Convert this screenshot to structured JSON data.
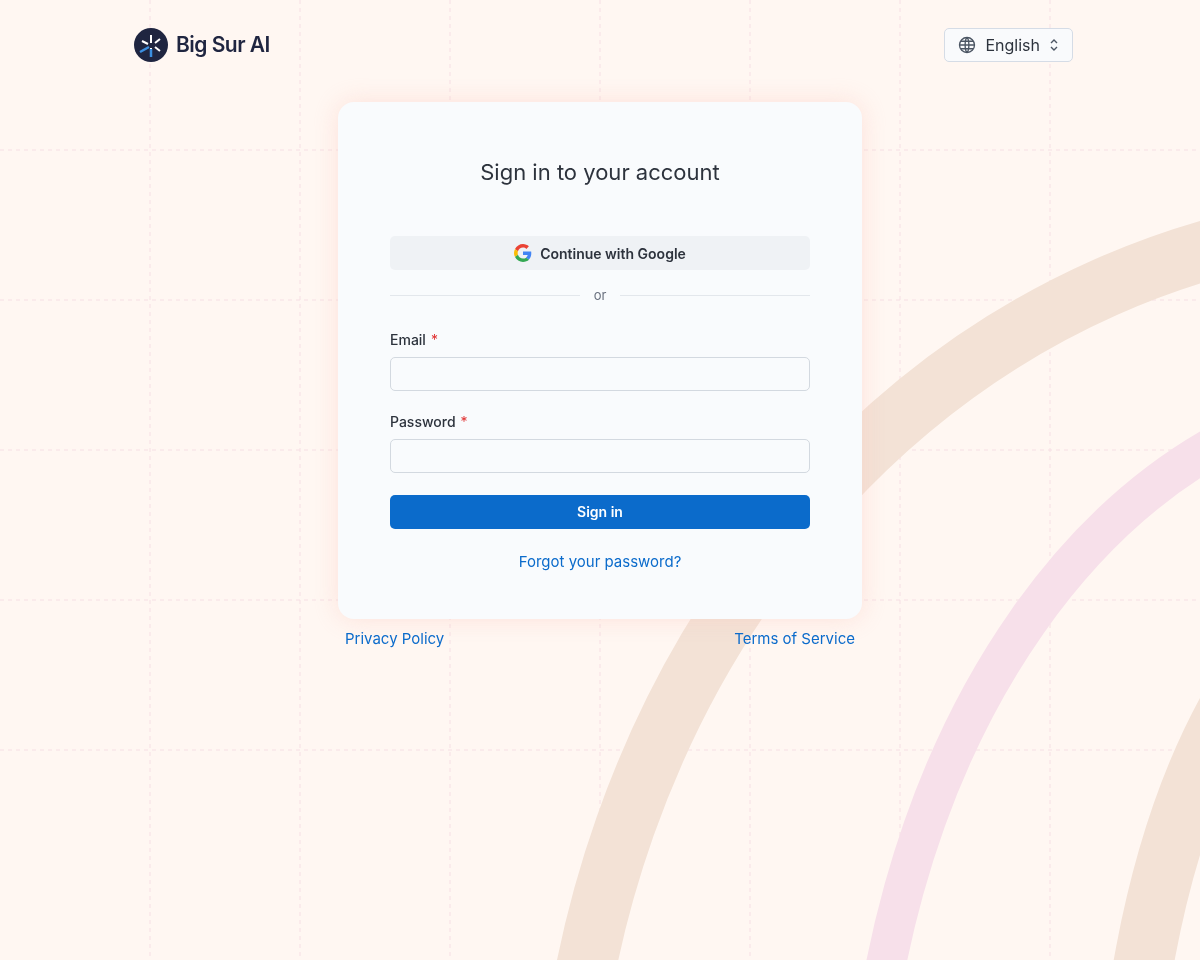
{
  "brand": {
    "name": "Big Sur AI"
  },
  "language": {
    "value": "English"
  },
  "card": {
    "title": "Sign in to your account",
    "google_button": "Continue with Google",
    "divider": "or",
    "fields": [
      {
        "label": "Email",
        "required_mark": "*"
      },
      {
        "label": "Password",
        "required_mark": "*"
      }
    ],
    "submit": "Sign in",
    "forgot_link": "Forgot your password?"
  },
  "footer_links": [
    "Privacy Policy",
    "Terms of Service"
  ]
}
